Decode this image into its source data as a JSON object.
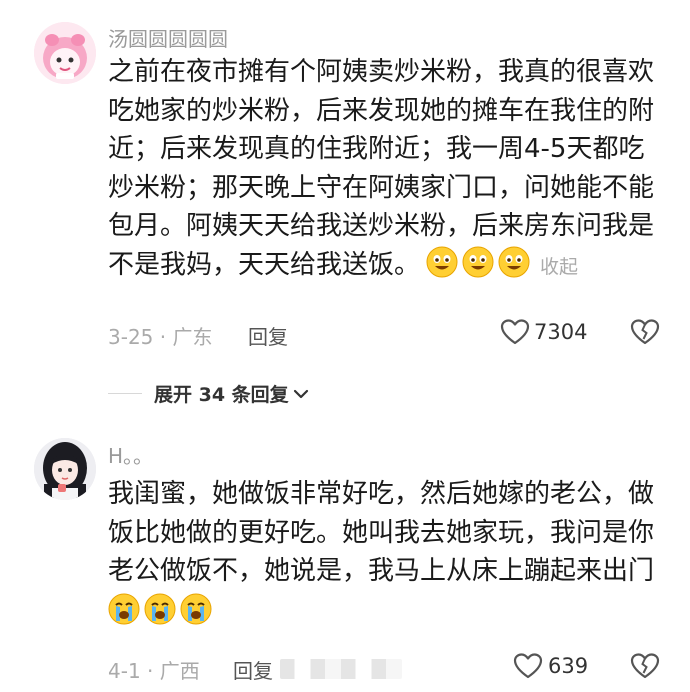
{
  "comments": [
    {
      "username": "汤圆圆圆圆圆",
      "lines": [
        "之前在夜市摊有个阿姨卖炒米粉，我真的很喜欢",
        "吃她家的炒米粉，后来发现她的摊车在我住的附",
        "近；后来发现真的住我附近；我一周4-5天都吃",
        "炒米粉；那天晚上守在阿姨家门口，问她能不能",
        "包月。阿姨天天给我送炒米粉，后来房东问我是",
        "不是我妈，天天给我送饭。"
      ],
      "emojis": [
        "grin-emoji",
        "grin-emoji",
        "grin-emoji"
      ],
      "collapse_label": "收起",
      "date_location": "3-25 · 广东",
      "reply_label": "回复",
      "like_count": "7304"
    },
    {
      "username": "H。。",
      "lines": [
        "我闺蜜，她做饭非常好吃，然后她嫁的老公，做",
        "饭比她做的更好吃。她叫我去她家玩，我问是你",
        "老公做饭不，她说是，我马上从床上蹦起来出门"
      ],
      "emojis": [
        "loudly-crying-emoji",
        "loudly-crying-emoji",
        "loudly-crying-emoji"
      ],
      "date_location": "4-1 · 广西",
      "reply_label": "回复",
      "like_count": "639"
    }
  ],
  "expand_replies_label": "展开 34 条回复"
}
